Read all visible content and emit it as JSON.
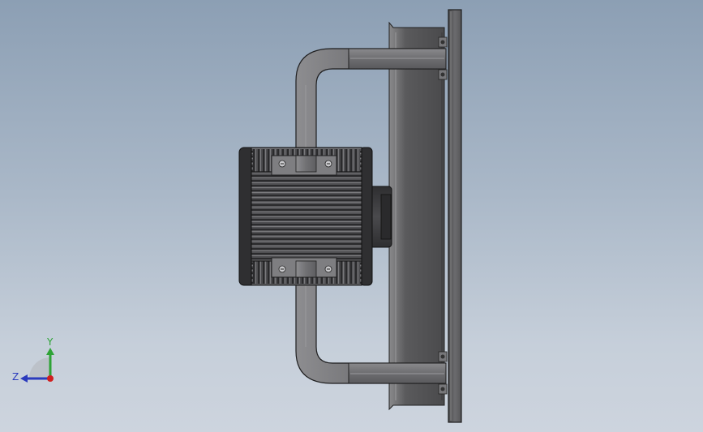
{
  "viewport": {
    "background_top": "#8c9fb4",
    "background_bottom": "#cdd4de"
  },
  "triad": {
    "x_label": "",
    "y_label": "Y",
    "z_label": "Z",
    "y_color": "#2ea336",
    "z_color": "#2b3bbd",
    "x_color": "#d02020"
  },
  "model": {
    "description_icon": "fan-motor-assembly-icon",
    "steel_color": "#6f6f72",
    "motor_color": "#3a3a3c"
  }
}
